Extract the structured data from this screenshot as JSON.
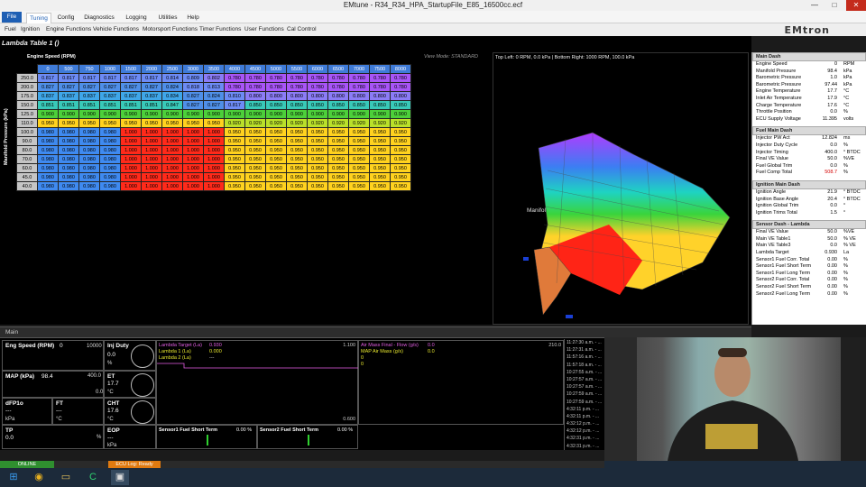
{
  "app": {
    "title": "EMtune - R34_R34_HPA_StartupFile_E85_16500cc.ecf",
    "win_buttons": [
      "—",
      "□",
      "✕"
    ]
  },
  "ribbon": {
    "tabs": [
      "File",
      "Tuning",
      "Config",
      "Diagnostics",
      "Logging",
      "Utilities",
      "Help"
    ]
  },
  "menu": {
    "items": [
      "Fuel",
      "Ignition",
      "Engine Functions",
      "Vehicle Functions",
      "Motorsport Functions",
      "Timer Functions",
      "User Functions",
      "Cal Control"
    ],
    "logo": "EMtron"
  },
  "table": {
    "title": "Lambda Table 1 ()",
    "view_mode": "View Mode: STANDARD",
    "x_axis_label": "Engine Speed (RPM)",
    "y_axis_label": "Manifold Pressure (kPa)",
    "x_axis": [
      "0",
      "500",
      "750",
      "1000",
      "1500",
      "2000",
      "2500",
      "3000",
      "3500",
      "4000",
      "4500",
      "5000",
      "5500",
      "6000",
      "6500",
      "7000",
      "7500",
      "8000"
    ],
    "y_axis": [
      "250.0",
      "200.0",
      "175.0",
      "150.0",
      "125.0",
      "110.0",
      "100.0",
      "90.0",
      "80.0",
      "70.0",
      "60.0",
      "45.0",
      "40.0"
    ],
    "rows": [
      [
        "0.817",
        "0.817",
        "0.817",
        "0.817",
        "0.817",
        "0.817",
        "0.814",
        "0.809",
        "0.802",
        "0.780",
        "0.780",
        "0.780",
        "0.780",
        "0.780",
        "0.780",
        "0.780",
        "0.780",
        "0.780"
      ],
      [
        "0.827",
        "0.827",
        "0.827",
        "0.827",
        "0.827",
        "0.827",
        "0.824",
        "0.818",
        "0.813",
        "0.780",
        "0.780",
        "0.780",
        "0.780",
        "0.780",
        "0.780",
        "0.780",
        "0.780",
        "0.780"
      ],
      [
        "0.837",
        "0.837",
        "0.837",
        "0.837",
        "0.837",
        "0.837",
        "0.834",
        "0.827",
        "0.824",
        "0.810",
        "0.800",
        "0.800",
        "0.800",
        "0.800",
        "0.800",
        "0.800",
        "0.800",
        "0.800"
      ],
      [
        "0.851",
        "0.851",
        "0.851",
        "0.851",
        "0.851",
        "0.851",
        "0.847",
        "0.827",
        "0.827",
        "0.817",
        "0.850",
        "0.850",
        "0.850",
        "0.850",
        "0.850",
        "0.850",
        "0.850",
        "0.850"
      ],
      [
        "0.900",
        "0.900",
        "0.900",
        "0.900",
        "0.900",
        "0.900",
        "0.900",
        "0.900",
        "0.900",
        "0.900",
        "0.900",
        "0.900",
        "0.900",
        "0.900",
        "0.900",
        "0.900",
        "0.900",
        "0.900"
      ],
      [
        "0.950",
        "0.950",
        "0.950",
        "0.950",
        "0.950",
        "0.950",
        "0.950",
        "0.950",
        "0.950",
        "0.920",
        "0.920",
        "0.920",
        "0.920",
        "0.920",
        "0.920",
        "0.920",
        "0.920",
        "0.920"
      ],
      [
        "0.980",
        "0.980",
        "0.980",
        "0.980",
        "1.000",
        "1.000",
        "1.000",
        "1.000",
        "1.000",
        "0.950",
        "0.950",
        "0.950",
        "0.950",
        "0.950",
        "0.950",
        "0.950",
        "0.950",
        "0.950"
      ],
      [
        "0.980",
        "0.980",
        "0.980",
        "0.980",
        "1.000",
        "1.000",
        "1.000",
        "1.000",
        "1.000",
        "0.950",
        "0.950",
        "0.950",
        "0.950",
        "0.950",
        "0.950",
        "0.950",
        "0.950",
        "0.950"
      ],
      [
        "0.980",
        "0.980",
        "0.980",
        "0.980",
        "1.000",
        "1.000",
        "1.000",
        "1.000",
        "1.000",
        "0.950",
        "0.950",
        "0.950",
        "0.950",
        "0.950",
        "0.950",
        "0.950",
        "0.950",
        "0.950"
      ],
      [
        "0.980",
        "0.980",
        "0.980",
        "0.980",
        "1.000",
        "1.000",
        "1.000",
        "1.000",
        "1.000",
        "0.950",
        "0.950",
        "0.950",
        "0.950",
        "0.950",
        "0.950",
        "0.950",
        "0.950",
        "0.950"
      ],
      [
        "0.980",
        "0.980",
        "0.980",
        "0.980",
        "1.000",
        "1.000",
        "1.000",
        "1.000",
        "1.000",
        "0.950",
        "0.950",
        "0.950",
        "0.950",
        "0.950",
        "0.950",
        "0.950",
        "0.950",
        "0.950"
      ],
      [
        "0.980",
        "0.980",
        "0.980",
        "0.980",
        "1.000",
        "1.000",
        "1.000",
        "1.000",
        "1.000",
        "0.950",
        "0.950",
        "0.950",
        "0.950",
        "0.950",
        "0.950",
        "0.950",
        "0.950",
        "0.950"
      ],
      [
        "0.980",
        "0.980",
        "0.980",
        "0.980",
        "1.000",
        "1.000",
        "1.000",
        "1.000",
        "1.000",
        "0.950",
        "0.950",
        "0.950",
        "0.950",
        "0.950",
        "0.950",
        "0.950",
        "0.950",
        "0.950"
      ]
    ],
    "cell_colors": {
      "0.78": "#a855f7",
      "0.80": "#8b7cf6",
      "0.81": "#6d8bf5",
      "0.82": "#4f8fe8",
      "0.83": "#3fa6e8",
      "0.85": "#38c9b8",
      "0.90": "#4ccf3a",
      "0.92": "#b9e02a",
      "0.95": "#ffd21f",
      "0.98": "#3f8af0",
      "1.00": "#ff2a1a"
    }
  },
  "view3d": {
    "info": "Top Left: 0 RPM, 0.0 kPa | Bottom Right: 1000 RPM, 100.0 kPa",
    "axis_label": "Manifol"
  },
  "dash": [
    {
      "header": "Main Dash",
      "rows": [
        {
          "label": "Engine Speed",
          "value": "0",
          "unit": "RPM"
        },
        {
          "label": "Manifold Pressure",
          "value": "98.4",
          "unit": "kPa"
        },
        {
          "label": "Barometric Pressure",
          "value": "1.0",
          "unit": "kPa"
        },
        {
          "label": "Barometric Pressure",
          "value": "97.44",
          "unit": "kPa"
        },
        {
          "label": "Engine Temperature",
          "value": "17.7",
          "unit": "°C"
        },
        {
          "label": "Inlet Air Temperature",
          "value": "17.9",
          "unit": "°C"
        },
        {
          "label": "Charge Temperature",
          "value": "17.6",
          "unit": "°C"
        },
        {
          "label": "Throttle Position",
          "value": "0.0",
          "unit": "%"
        },
        {
          "label": "ECU Supply Voltage",
          "value": "11.395",
          "unit": "volts"
        }
      ]
    },
    {
      "header": "Fuel Main Dash",
      "rows": [
        {
          "label": "Injector PW Act",
          "value": "12.824",
          "unit": "ms"
        },
        {
          "label": "Injector Duty Cycle",
          "value": "0.0",
          "unit": "%"
        },
        {
          "label": "Injector Timing",
          "value": "400.0",
          "unit": "° BTDC"
        },
        {
          "label": "Final VE Value",
          "value": "50.0",
          "unit": "%VE"
        },
        {
          "label": "Fuel Global Trim",
          "value": "0.0",
          "unit": "%"
        },
        {
          "label": "Fuel Comp Total",
          "value": "508.7",
          "unit": "%",
          "red": true
        }
      ]
    },
    {
      "header": "Ignition Main Dash",
      "rows": [
        {
          "label": "Ignition Angle",
          "value": "21.9",
          "unit": "° BTDC"
        },
        {
          "label": "Ignition Base Angle",
          "value": "20.4",
          "unit": "° BTDC"
        },
        {
          "label": "Ignition Global Trim",
          "value": "0.0",
          "unit": "°"
        },
        {
          "label": "Ignition Trims Total",
          "value": "1.5",
          "unit": "°"
        }
      ]
    },
    {
      "header": "Sensor Dash - Lambda",
      "rows": [
        {
          "label": "Final VE Value",
          "value": "50.0",
          "unit": "%VE"
        },
        {
          "label": "Main VE Table1",
          "value": "50.0",
          "unit": "% VE"
        },
        {
          "label": "Main VE Table3",
          "value": "0.0",
          "unit": "% VE"
        },
        {
          "label": "Lambda Target",
          "value": "0.930",
          "unit": "La"
        },
        {
          "label": "Sensor1 Fuel Corr. Total",
          "value": "0.00",
          "unit": "%"
        },
        {
          "label": "Sensor1 Fuel Short Term",
          "value": "0.00",
          "unit": "%"
        },
        {
          "label": "Sensor1 Fuel Long Term",
          "value": "0.00",
          "unit": "%"
        },
        {
          "label": "Sensor2 Fuel Corr. Total",
          "value": "0.00",
          "unit": "%"
        },
        {
          "label": "Sensor2 Fuel Short Term",
          "value": "0.00",
          "unit": "%"
        },
        {
          "label": "Sensor2 Fuel Long Term",
          "value": "0.00",
          "unit": "%"
        }
      ]
    }
  ],
  "main_label": "Main",
  "gauges": {
    "eng_speed": {
      "label": "Eng Speed (RPM)",
      "value": "0",
      "max": "10000"
    },
    "inj_duty": {
      "label": "Inj Duty",
      "value": "0.0",
      "unit": "%"
    },
    "map": {
      "label": "MAP (kPa)",
      "value": "98.4",
      "max": "400.0",
      "min": "0.0"
    },
    "et": {
      "label": "ET",
      "value": "17.7",
      "unit": "°C"
    },
    "dfp": {
      "label": "dFP1o",
      "value": "---",
      "unit": "kPa"
    },
    "ft": {
      "label": "FT",
      "value": "---",
      "unit": "°C"
    },
    "cht": {
      "label": "CHT",
      "value": "17.6",
      "unit": "°C"
    },
    "tp": {
      "label": "TP",
      "value": "0.0",
      "unit": "%"
    },
    "eop": {
      "label": "EOP",
      "value": "---",
      "unit": "kPa"
    }
  },
  "lambda_chart": {
    "line1": "Lambda Target (La)",
    "val1": "0.930",
    "line2": "Lambda 1 (La)",
    "val2": "0.000",
    "line3": "Lambda 2 (La)",
    "val3": "---",
    "max": "1.100",
    "min": "0.600"
  },
  "air_chart": {
    "line1": "Air Mass Final - Flow (g/s)",
    "val1": "0.0",
    "line2": "MAP Air Mass (g/s)",
    "val2": "0.0",
    "v3": "0",
    "v4": "0",
    "max": "210.0"
  },
  "trims": {
    "s1": "Sensor1 Fuel Short Term",
    "s1v": "0.00 %",
    "s2": "Sensor2 Fuel Short Term",
    "s2v": "0.00 %"
  },
  "timestamps": [
    "11:27:30 a.m. - ...",
    "11:27:31 a.m. - ...",
    "11:57:16 a.m. - ...",
    "11:57:18 a.m. - ...",
    "10:27:55 a.m. - ...",
    "10:27:57 a.m. - ...",
    "10:27:57 a.m. - ...",
    "10:27:59 a.m. - ...",
    "10:27:59 a.m. - ...",
    "4:32:11 p.m. - ...",
    "4:32:11 p.m. - ...",
    "4:32:12 p.m. - ...",
    "4:32:12 p.m. - ...",
    "4:32:31 p.m. - ...",
    "4:32:31 p.m. - ..."
  ],
  "status": {
    "online": "ONLINE",
    "ecu_log": "ECU Log: Ready"
  }
}
